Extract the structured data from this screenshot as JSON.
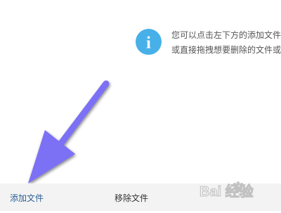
{
  "info": {
    "icon": "info-icon",
    "icon_color": "#47b0e8",
    "icon_glyph": "i",
    "line1": "您可以点击左下方的添加文件",
    "line2": "或直接拖拽想要删除的文件或"
  },
  "arrow": {
    "color": "#7b6ff5",
    "icon": "arrow-down-left-icon"
  },
  "toolbar": {
    "add_label": "添加文件",
    "remove_label": "移除文件"
  },
  "watermark": {
    "text": "Bai 经验",
    "icon": "baidu-paw-icon"
  }
}
